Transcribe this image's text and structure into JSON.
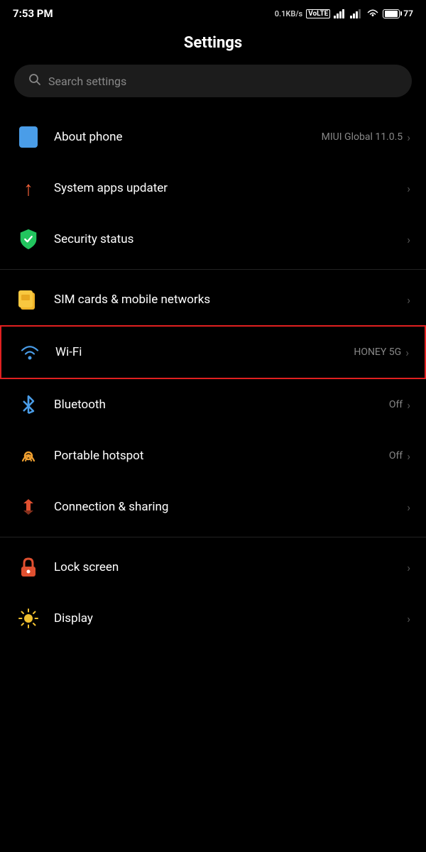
{
  "statusBar": {
    "time": "7:53 PM",
    "speed": "0.1KB/s",
    "networkType": "VoLTE",
    "batteryPercent": "77"
  },
  "page": {
    "title": "Settings"
  },
  "search": {
    "placeholder": "Search settings"
  },
  "settingsItems": [
    {
      "id": "about-phone",
      "label": "About phone",
      "value": "MIUI Global 11.0.5",
      "iconType": "about",
      "hasChevron": true
    },
    {
      "id": "system-apps-updater",
      "label": "System apps updater",
      "value": "",
      "iconType": "updater",
      "hasChevron": true
    },
    {
      "id": "security-status",
      "label": "Security status",
      "value": "",
      "iconType": "security",
      "hasChevron": true
    },
    {
      "id": "sim-cards",
      "label": "SIM cards & mobile networks",
      "value": "",
      "iconType": "sim",
      "hasChevron": true
    },
    {
      "id": "wifi",
      "label": "Wi-Fi",
      "value": "HONEY 5G",
      "iconType": "wifi",
      "hasChevron": true,
      "highlighted": true
    },
    {
      "id": "bluetooth",
      "label": "Bluetooth",
      "value": "Off",
      "iconType": "bluetooth",
      "hasChevron": true
    },
    {
      "id": "portable-hotspot",
      "label": "Portable hotspot",
      "value": "Off",
      "iconType": "hotspot",
      "hasChevron": true
    },
    {
      "id": "connection-sharing",
      "label": "Connection & sharing",
      "value": "",
      "iconType": "connection",
      "hasChevron": true
    },
    {
      "id": "lock-screen",
      "label": "Lock screen",
      "value": "",
      "iconType": "lock",
      "hasChevron": true
    },
    {
      "id": "display",
      "label": "Display",
      "value": "",
      "iconType": "display",
      "hasChevron": true
    }
  ],
  "dividers": [
    2,
    3,
    7,
    8
  ],
  "labels": {
    "chevron": "›",
    "battery": "77"
  }
}
